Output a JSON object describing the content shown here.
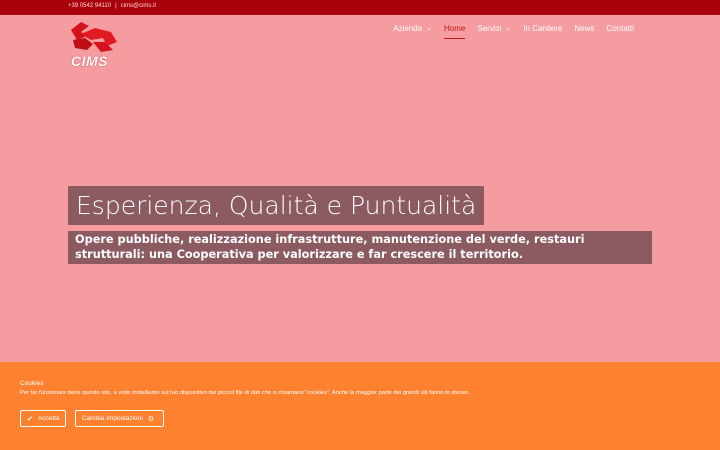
{
  "topbar": {
    "phone": "+39 0542 94110",
    "separator": "|",
    "email": "cims@cims.it"
  },
  "logo": {
    "text": "CIMS"
  },
  "nav": {
    "items": [
      {
        "label": "Azienda",
        "dropdown": true,
        "active": false
      },
      {
        "label": "Home",
        "dropdown": false,
        "active": true
      },
      {
        "label": "Servizi",
        "dropdown": true,
        "active": false
      },
      {
        "label": "In Cantiere",
        "dropdown": false,
        "active": false
      },
      {
        "label": "News",
        "dropdown": false,
        "active": false
      },
      {
        "label": "Contatti",
        "dropdown": false,
        "active": false
      }
    ]
  },
  "hero": {
    "title": "Esperienza, Qualità e Puntualità",
    "subtitle": "Opere pubbliche, realizzazione infrastrutture, manutenzione del verde, restauri strutturali: una Cooperativa per valorizzare e far crescere il territorio."
  },
  "cookie": {
    "title": "Cookies",
    "text": "Per far funzionare bene questo sito, a volte installiamo sul tuo dispositivo dei piccoli file di dati che si chiamano \"cookies\". Anche la maggior parte dei grandi siti fanno lo stesso.",
    "accept_label": "Accetta",
    "settings_label": "Cambia Impostazioni"
  },
  "colors": {
    "topbar": "#a9000b",
    "background": "#f49ca0",
    "nav_active": "#c81a16",
    "hero_box": "#8c5b61",
    "cookie_bar": "#fe8130"
  },
  "icons": {
    "accept": "check-icon",
    "settings": "gear-icon",
    "dropdown": "chevron-down-icon"
  }
}
